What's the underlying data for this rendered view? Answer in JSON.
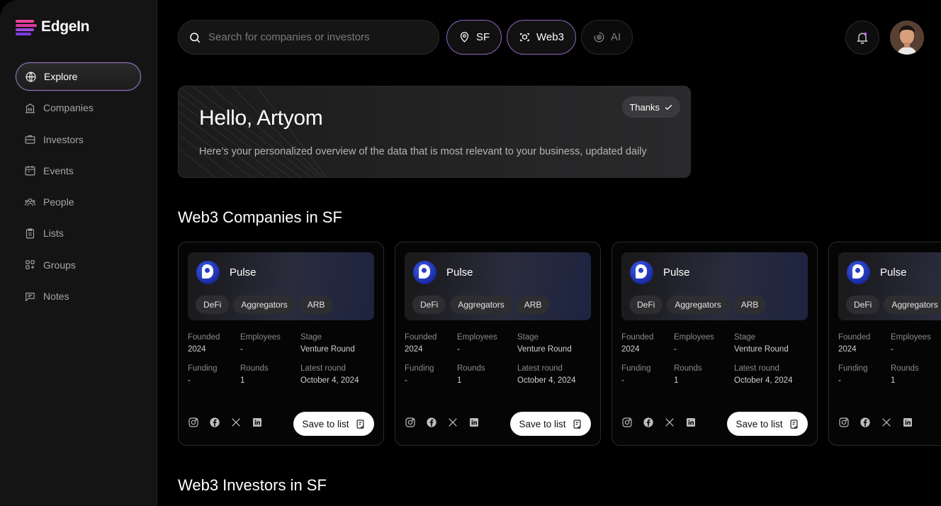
{
  "brand": {
    "name": "EdgeIn"
  },
  "sidebar": {
    "items": [
      {
        "label": "Explore",
        "icon": "globe-icon"
      },
      {
        "label": "Companies",
        "icon": "building-icon"
      },
      {
        "label": "Investors",
        "icon": "briefcase-icon"
      },
      {
        "label": "Events",
        "icon": "calendar-icon"
      },
      {
        "label": "People",
        "icon": "people-icon"
      },
      {
        "label": "Lists",
        "icon": "clipboard-icon"
      },
      {
        "label": "Groups",
        "icon": "grid-plus-icon"
      },
      {
        "label": "Notes",
        "icon": "note-icon"
      }
    ]
  },
  "search": {
    "placeholder": "Search for companies or investors",
    "value": ""
  },
  "filters": [
    {
      "label": "SF",
      "icon": "location-pin-icon",
      "selected": true
    },
    {
      "label": "Web3",
      "icon": "web3-scan-icon",
      "selected": true
    },
    {
      "label": "AI",
      "icon": "ai-target-icon",
      "selected": false
    }
  ],
  "hero": {
    "title": "Hello, Artyom",
    "subtitle": "Here’s your personalized overview of the data that is most relevant to your business, updated daily",
    "thanks_label": "Thanks"
  },
  "sections": {
    "companies_title": "Web3 Companies in SF",
    "investors_title": "Web3 Investors in SF"
  },
  "card_labels": {
    "founded": "Founded",
    "employees": "Employees",
    "stage": "Stage",
    "funding": "Funding",
    "rounds": "Rounds",
    "latest_round": "Latest round",
    "save": "Save to list"
  },
  "cards": [
    {
      "name": "Pulse",
      "tags": [
        "DeFi",
        "Aggregators",
        "ARB"
      ],
      "founded": "2024",
      "employees": "-",
      "stage": "Venture Round",
      "funding": "-",
      "rounds": "1",
      "latest_round": "October 4, 2024"
    },
    {
      "name": "Pulse",
      "tags": [
        "DeFi",
        "Aggregators",
        "ARB"
      ],
      "founded": "2024",
      "employees": "-",
      "stage": "Venture Round",
      "funding": "-",
      "rounds": "1",
      "latest_round": "October 4, 2024"
    },
    {
      "name": "Pulse",
      "tags": [
        "DeFi",
        "Aggregators",
        "ARB"
      ],
      "founded": "2024",
      "employees": "-",
      "stage": "Venture Round",
      "funding": "-",
      "rounds": "1",
      "latest_round": "October 4, 2024"
    },
    {
      "name": "Pulse",
      "tags": [
        "DeFi",
        "Aggregators"
      ],
      "founded": "2024",
      "employees": "-",
      "funding": "-",
      "rounds": "1"
    }
  ],
  "colors": {
    "accent": "#8d66c6",
    "background": "#000000",
    "sidebar": "#141414"
  }
}
